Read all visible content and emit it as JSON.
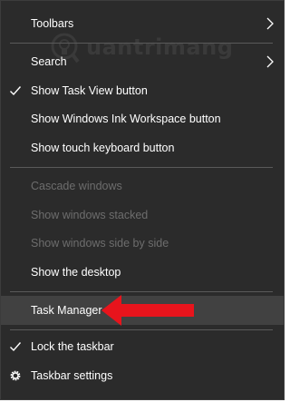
{
  "menu": {
    "items": [
      {
        "label": "Toolbars",
        "checked": false,
        "submenu": true,
        "enabled": true
      },
      {
        "label": "Search",
        "checked": false,
        "submenu": true,
        "enabled": true
      },
      {
        "label": "Show Task View button",
        "checked": true,
        "submenu": false,
        "enabled": true
      },
      {
        "label": "Show Windows Ink Workspace button",
        "checked": false,
        "submenu": false,
        "enabled": true
      },
      {
        "label": "Show touch keyboard button",
        "checked": false,
        "submenu": false,
        "enabled": true
      },
      {
        "label": "Cascade windows",
        "checked": false,
        "submenu": false,
        "enabled": false
      },
      {
        "label": "Show windows stacked",
        "checked": false,
        "submenu": false,
        "enabled": false
      },
      {
        "label": "Show windows side by side",
        "checked": false,
        "submenu": false,
        "enabled": false
      },
      {
        "label": "Show the desktop",
        "checked": false,
        "submenu": false,
        "enabled": true
      },
      {
        "label": "Task Manager",
        "checked": false,
        "submenu": false,
        "enabled": true,
        "highlighted": true
      },
      {
        "label": "Lock the taskbar",
        "checked": true,
        "submenu": false,
        "enabled": true
      },
      {
        "label": "Taskbar settings",
        "checked": false,
        "submenu": false,
        "enabled": true,
        "icon": "gear-icon"
      }
    ]
  },
  "watermark": {
    "text": "uantrimang",
    "icon": "lightbulb-logo"
  },
  "annotation": {
    "icon": "red-arrow-left",
    "color": "#e8141c"
  },
  "colors": {
    "menu_bg": "#2b2b2b",
    "text": "#ffffff",
    "disabled_text": "#6d6d6d",
    "highlight_bg": "#414141",
    "separator": "#5a5a5a"
  }
}
